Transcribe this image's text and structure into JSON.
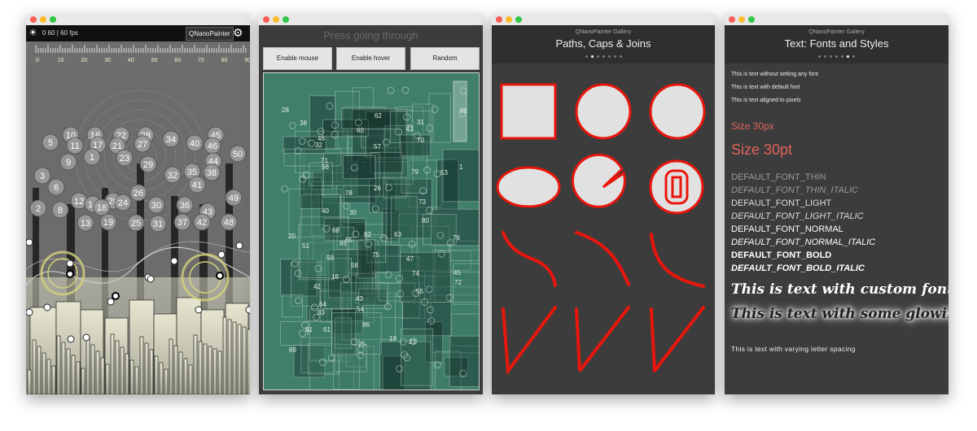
{
  "window1": {
    "fps_text": "0 60 | 60 fps",
    "button": "QNanoPainter",
    "ruler_ticks": [
      "0",
      "10",
      "20",
      "30",
      "40",
      "50",
      "60",
      "70",
      "80",
      "90"
    ],
    "circles": [
      "10",
      "16",
      "22",
      "28",
      "45",
      "5",
      "11",
      "17",
      "21",
      "27",
      "34",
      "40",
      "46",
      "50",
      "9",
      "1",
      "23",
      "44",
      "3",
      "29",
      "32",
      "35",
      "38",
      "6",
      "41",
      "12",
      "14",
      "20",
      "26",
      "49",
      "2",
      "8",
      "18",
      "24",
      "30",
      "36",
      "43",
      "13",
      "19",
      "25",
      "31",
      "37",
      "42",
      "48"
    ]
  },
  "window2": {
    "title": "Press going through",
    "buttons": [
      "Enable mouse",
      "Enable hover",
      "Random"
    ],
    "box_labels": [
      "28",
      "89",
      "38",
      "60",
      "62",
      "41",
      "31",
      "46",
      "32",
      "57",
      "70",
      "71",
      "56",
      "79",
      "53",
      "1",
      "26",
      "78",
      "73",
      "40",
      "30",
      "80",
      "20",
      "68",
      "82",
      "63",
      "76",
      "51",
      "85",
      "65",
      "47",
      "59",
      "58",
      "75",
      "16",
      "74",
      "45",
      "55",
      "72",
      "42",
      "43",
      "64",
      "83",
      "54",
      "7",
      "86",
      "81",
      "61",
      "19",
      "25",
      "69",
      "23"
    ]
  },
  "window3": {
    "subtitle": "QNanoPainter Gallery",
    "title": "Paths, Caps & Joins",
    "page_count": 7,
    "active_page": 1,
    "stroke_color": "#e8160c",
    "fill_color": "#e1e1e1"
  },
  "window4": {
    "subtitle": "QNanoPainter Gallery",
    "title": "Text: Fonts and Styles",
    "page_count": 7,
    "active_page": 5,
    "lines": [
      "This is text without setting any font",
      "This is text with default font",
      "This is text aligned to pixels",
      "Size 30px",
      "Size 30pt",
      "DEFAULT_FONT_THIN",
      "DEFAULT_FONT_THIN_ITALIC",
      "DEFAULT_FONT_LIGHT",
      "DEFAULT_FONT_LIGHT_ITALIC",
      "DEFAULT_FONT_NORMAL",
      "DEFAULT_FONT_NORMAL_ITALIC",
      "DEFAULT_FONT_BOLD",
      "DEFAULT_FONT_BOLD_ITALIC",
      "This is text with custom font",
      "This is text with some glowing",
      "This is text with varying letter spacing"
    ],
    "size_color": "#e0625a"
  }
}
